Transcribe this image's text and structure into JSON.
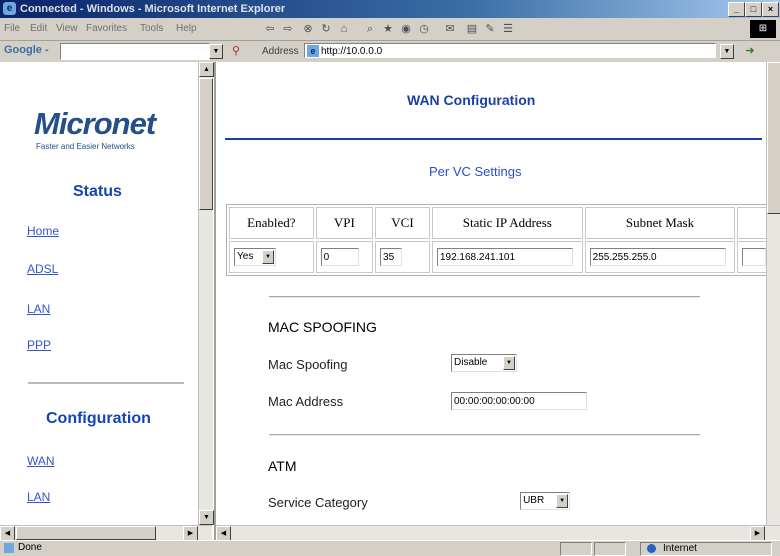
{
  "window": {
    "title": "Connected - Windows - Microsoft Internet Explorer",
    "min_glyph": "_",
    "max_glyph": "□",
    "close_glyph": "×"
  },
  "menu": {
    "items": [
      "File",
      "Edit",
      "View",
      "Favorites",
      "Tools",
      "Help"
    ]
  },
  "google_toolbar": {
    "logo": "Google -",
    "search_value": ""
  },
  "address_bar": {
    "label": "Address",
    "url": "http://10.0.0.0"
  },
  "sidebar": {
    "logo_text": "Micronet",
    "tagline": "Faster and Easier Networks",
    "status_heading": "Status",
    "status_links": [
      "Home",
      "ADSL",
      "LAN",
      "PPP"
    ],
    "config_heading": "Configuration",
    "config_links": [
      "WAN",
      "LAN"
    ]
  },
  "main": {
    "title": "WAN Configuration",
    "vc_subtitle": "Per VC Settings",
    "vc_table": {
      "headers": [
        "Enabled?",
        "VPI",
        "VCI",
        "Static IP Address",
        "Subnet Mask"
      ],
      "row": {
        "enabled": "Yes",
        "vpi": "0",
        "vci": "35",
        "static_ip": "192.168.241.101",
        "subnet": "255.255.255.0"
      }
    },
    "mac_spoofing": {
      "heading": "MAC SPOOFING",
      "mode_label": "Mac Spoofing",
      "mode_value": "Disable",
      "address_label": "Mac Address",
      "address_value": "00:00:00:00:00:00"
    },
    "atm": {
      "heading": "ATM",
      "service_label": "Service Category",
      "service_value": "UBR"
    }
  },
  "statusbar": {
    "status": "Done",
    "zone": "Internet"
  }
}
